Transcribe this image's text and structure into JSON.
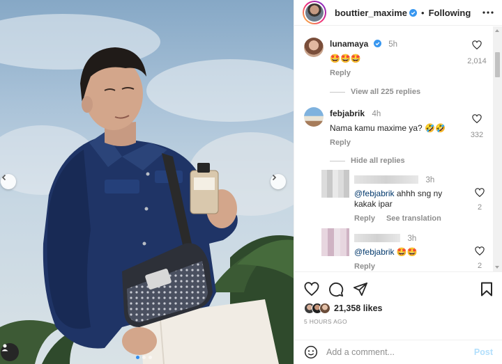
{
  "header": {
    "username": "bouttier_maxime",
    "separator": "•",
    "follow_label": "Following"
  },
  "comments": [
    {
      "username": "lunamaya",
      "time": "5h",
      "text": "🤩🤩🤩",
      "reply_label": "Reply",
      "like_count": "2,014",
      "replies_toggle": "View all 225 replies"
    },
    {
      "username": "febjabrik",
      "time": "4h",
      "text": "Nama kamu maxime ya? 🤣🤣",
      "reply_label": "Reply",
      "like_count": "332",
      "replies_toggle": "Hide all replies"
    }
  ],
  "replies": [
    {
      "time": "3h",
      "mention": "@febjabrik",
      "text": " ahhh sng ny kakak ipar",
      "reply_label": "Reply",
      "translate_label": "See translation",
      "like_count": "2"
    },
    {
      "time": "3h",
      "mention": "@febjabrik",
      "text": " 🤩🤩",
      "reply_label": "Reply",
      "like_count": "2"
    }
  ],
  "actions": {
    "likes": "21,358 likes",
    "time_ago": "5 HOURS AGO"
  },
  "composer": {
    "placeholder": "Add a comment...",
    "post_label": "Post"
  },
  "carousel": {
    "slide_count": 3,
    "active_slide": 1
  },
  "colors": {
    "verified": "#3897f0",
    "link": "#00376b",
    "post_disabled": "#b2dffc",
    "secondary_text": "#8e8e8e"
  },
  "icons": {
    "carousel": [
      "chevron-left-icon",
      "chevron-right-icon",
      "user-tag-icon"
    ],
    "actions": [
      "heart-icon",
      "comment-icon",
      "share-icon",
      "bookmark-icon",
      "emoji-icon",
      "more-icon"
    ]
  }
}
